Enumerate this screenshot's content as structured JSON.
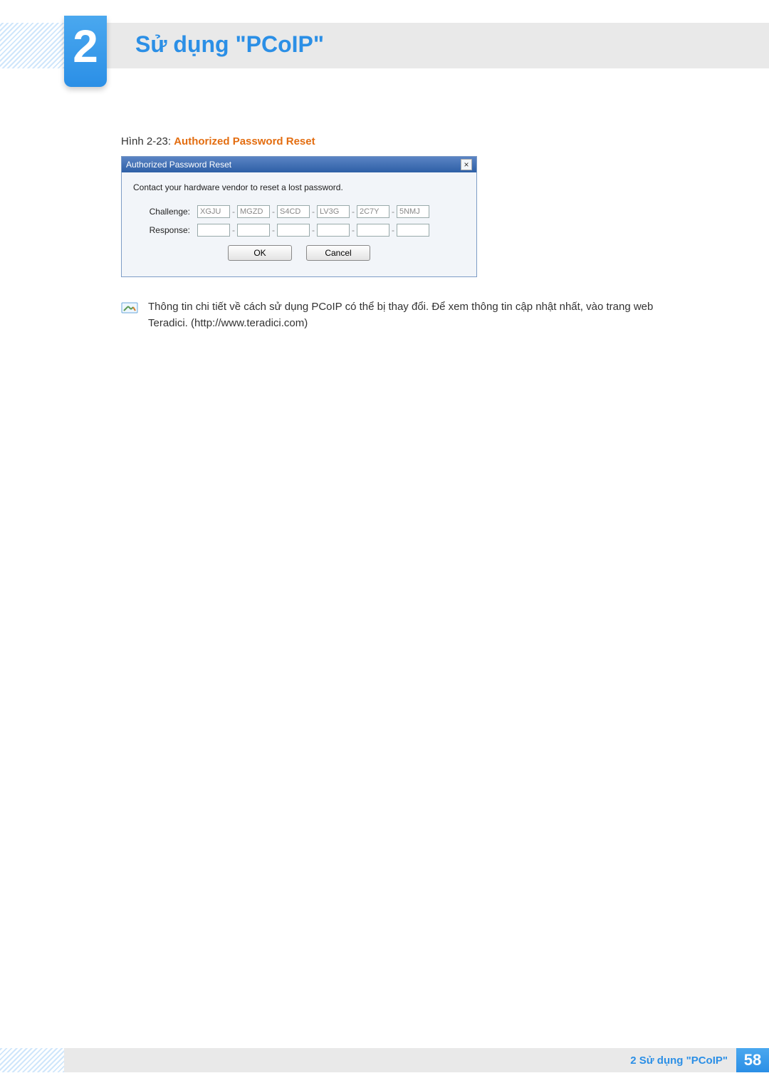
{
  "header": {
    "chapter_number": "2",
    "chapter_title": "Sử dụng \"PCoIP\""
  },
  "figure": {
    "label_prefix": "Hình 2-23: ",
    "label_title": "Authorized Password Reset"
  },
  "dialog": {
    "title": "Authorized Password Reset",
    "close_glyph": "×",
    "instruction": "Contact your hardware vendor to reset a lost password.",
    "challenge_label": "Challenge:",
    "response_label": "Response:",
    "challenge_segments": [
      "XGJU",
      "MGZD",
      "S4CD",
      "LV3G",
      "2C7Y",
      "5NMJ"
    ],
    "response_segments": [
      "",
      "",
      "",
      "",
      "",
      ""
    ],
    "ok_label": "OK",
    "cancel_label": "Cancel"
  },
  "note": {
    "text": "Thông tin chi tiết về cách sử dụng PCoIP có thể bị thay đổi. Để xem thông tin cập nhật nhất, vào trang web Teradici. (http://www.teradici.com)"
  },
  "footer": {
    "chapter_ref": "2 Sử dụng \"PCoIP\"",
    "page_number": "58"
  }
}
